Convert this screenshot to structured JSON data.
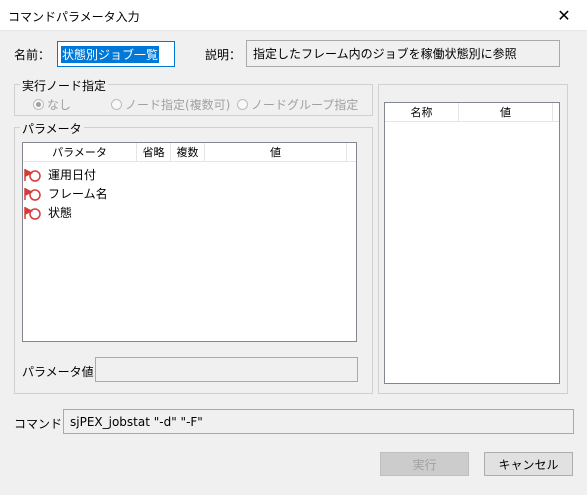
{
  "window": {
    "title": "コマンドパラメータ入力",
    "close_glyph": "✕"
  },
  "name": {
    "label": "名前：",
    "value": "状態別ジョブ一覧"
  },
  "description": {
    "label": "説明：",
    "value": "指定したフレーム内のジョブを稼働状態別に参照"
  },
  "exec_node": {
    "label": "実行ノード指定",
    "options": [
      {
        "label": "なし",
        "checked": true
      },
      {
        "label": "ノード指定(複数可)",
        "checked": false
      },
      {
        "label": "ノードグループ指定",
        "checked": false
      }
    ]
  },
  "params": {
    "label": "パラメータ",
    "columns": [
      "パラメータ",
      "省略",
      "複数",
      "値"
    ],
    "rows": [
      {
        "name": "運用日付",
        "icon": "required-param-icon"
      },
      {
        "name": "フレーム名",
        "icon": "required-param-icon"
      },
      {
        "name": "状態",
        "icon": "required-param-icon"
      }
    ],
    "value_label": "パラメータ値：",
    "value": ""
  },
  "side_list": {
    "columns": [
      "名称",
      "値"
    ]
  },
  "command": {
    "label": "コマンド：",
    "value": "sjPEX_jobstat \"-d\" \"-F\""
  },
  "buttons": {
    "execute": "実行",
    "cancel": "キャンセル"
  },
  "colors": {
    "accent": "#0078d7",
    "icon_red": "#d63b3b"
  }
}
